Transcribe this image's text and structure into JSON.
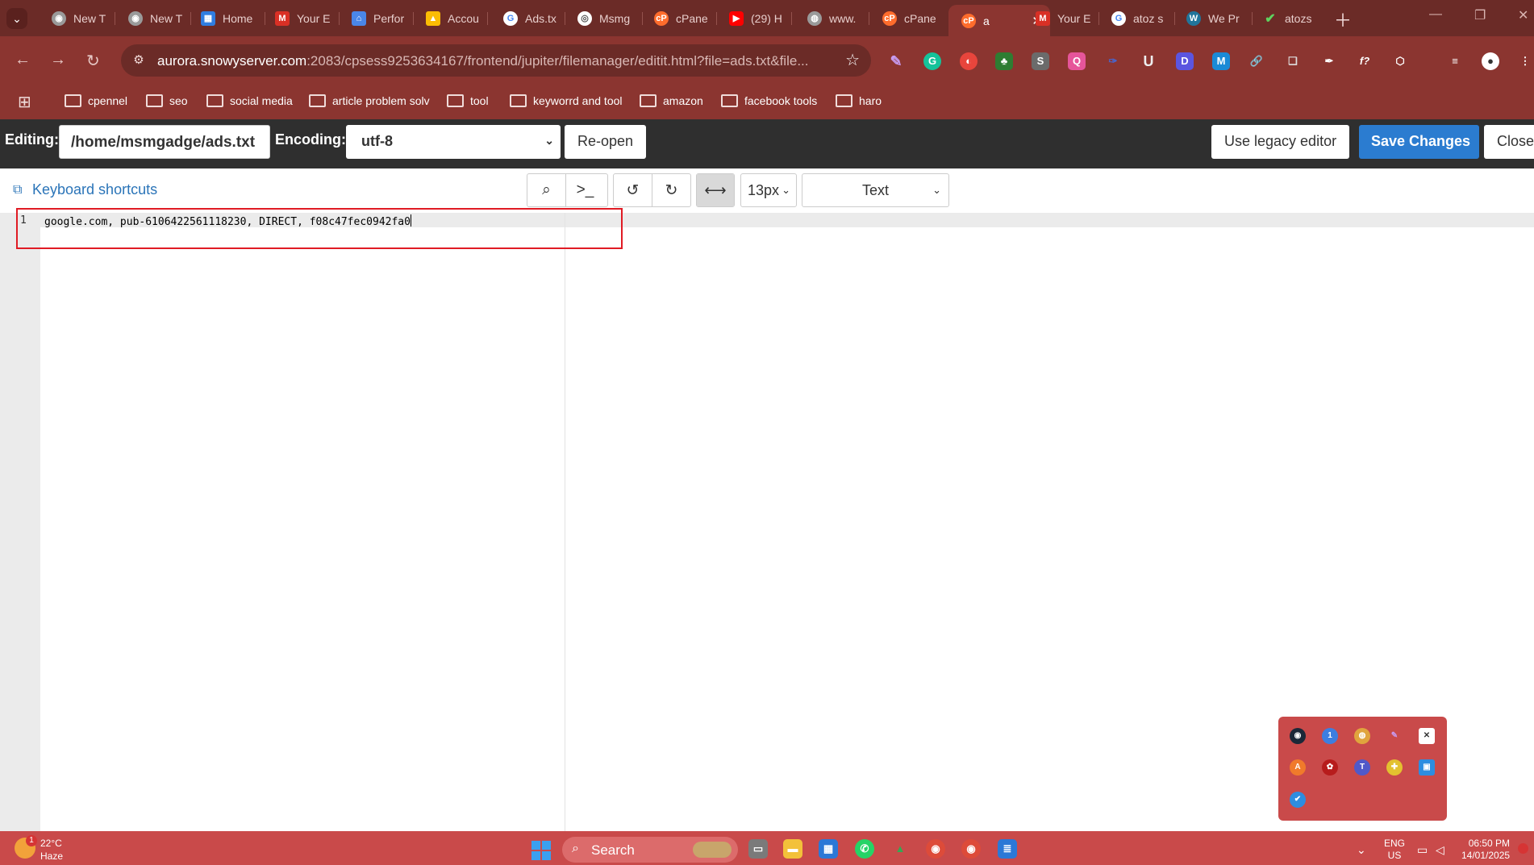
{
  "browser": {
    "tabs": [
      {
        "label": "New T",
        "icon": "chrome-icon"
      },
      {
        "label": "New T",
        "icon": "chrome-icon"
      },
      {
        "label": "Home",
        "icon": "home-grid-icon"
      },
      {
        "label": "Your E",
        "icon": "gmail-icon"
      },
      {
        "label": "Perfor",
        "icon": "storefront-icon"
      },
      {
        "label": "Accou",
        "icon": "google-ads-icon"
      },
      {
        "label": "Ads.tx",
        "icon": "google-icon"
      },
      {
        "label": "Msmg",
        "icon": "site-icon"
      },
      {
        "label": "cPane",
        "icon": "cpanel-icon"
      },
      {
        "label": "(29) H",
        "icon": "youtube-icon"
      },
      {
        "label": "www.",
        "icon": "globe-icon"
      },
      {
        "label": "cPane",
        "icon": "cpanel-icon"
      },
      {
        "label": "a",
        "icon": "cpanel-icon",
        "active": true
      },
      {
        "label": "Your E",
        "icon": "gmail-icon"
      },
      {
        "label": "atoz s",
        "icon": "google-icon"
      },
      {
        "label": "We Pr",
        "icon": "wordpress-icon"
      },
      {
        "label": "atozs",
        "icon": "check-icon"
      }
    ],
    "url": {
      "host": "aurora.snowyserver.com",
      "rest": ":2083/cpsess9253634167/frontend/jupiter/filemanager/editit.html?file=ads.txt&file..."
    },
    "bookmarks": [
      "cpennel",
      "seo",
      "social media",
      "article problem solv",
      "tool",
      "keyworrd and tool",
      "amazon",
      "facebook tools",
      "haro"
    ]
  },
  "editor": {
    "editing_label": "Editing:",
    "file_path": "/home/msmgadge/ads.txt",
    "encoding_label": "Encoding:",
    "encoding_value": "utf-8",
    "reopen_label": "Re-open",
    "legacy_label": "Use legacy editor",
    "save_label": "Save Changes",
    "close_label": "Close",
    "keyboard_shortcuts_label": "Keyboard shortcuts",
    "font_size": "13px",
    "mode": "Text",
    "line_number": "1",
    "code_line": "google.com, pub-6106422561118230, DIRECT, f08c47fec0942fa0"
  },
  "taskbar": {
    "temperature": "22°C",
    "weather": "Haze",
    "weather_badge": "1",
    "search_label": "Search",
    "lang_line1": "ENG",
    "lang_line2": "US",
    "time": "06:50 PM",
    "date": "14/01/2025"
  },
  "colors": {
    "chrome_dark": "#6b2b27",
    "chrome": "#8b3530",
    "editor_header": "#2f2f2f",
    "save_blue": "#2b7cd0",
    "link_blue": "#2a74b8",
    "highlight_red": "#e01b24",
    "taskbar": "#c94a4a"
  }
}
